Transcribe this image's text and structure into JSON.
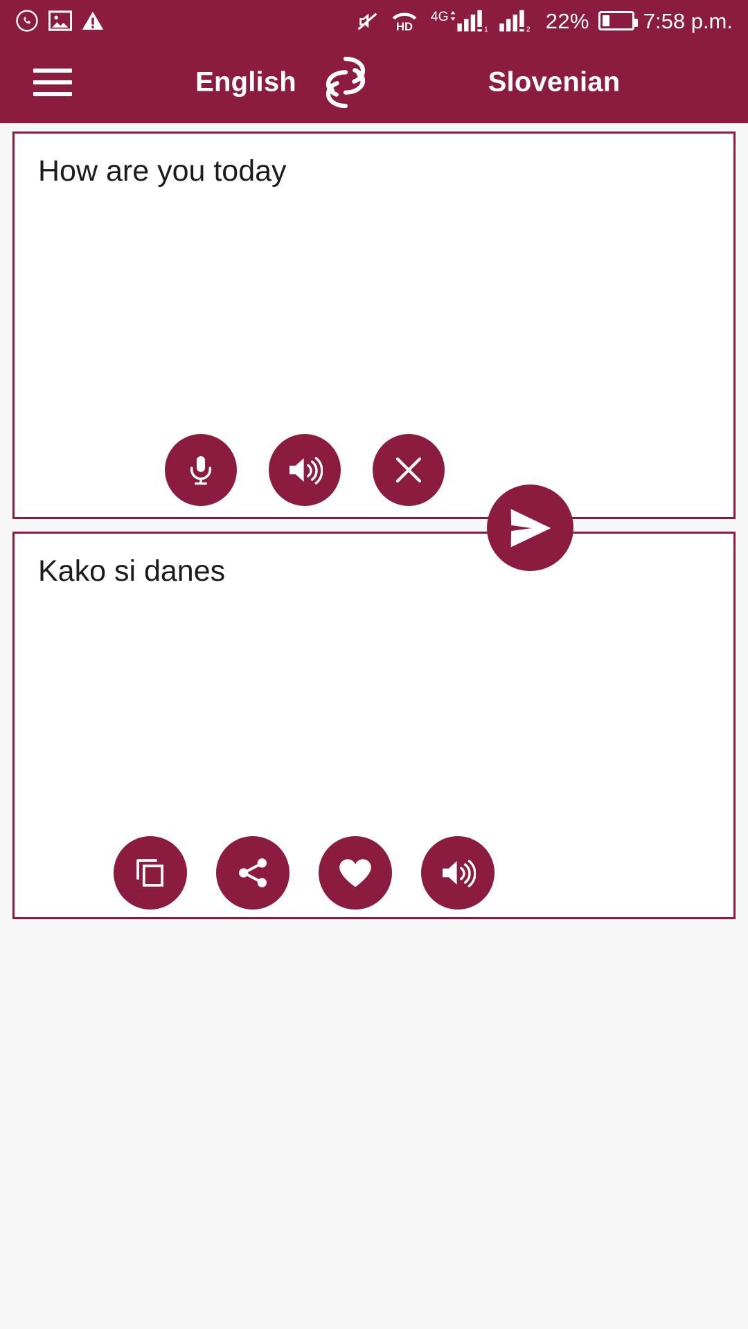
{
  "status_bar": {
    "left_icons": [
      "whatsapp-icon",
      "screenshot-image-icon",
      "warning-triangle-icon"
    ],
    "right_icons": [
      "silent-mode-icon",
      "volte-hd-icon",
      "signal-4g-icon",
      "signal-bars-icon"
    ],
    "network_label": "4G",
    "hd_label": "HD",
    "battery_percent": "22%",
    "battery_level": 22,
    "time": "7:58 p.m."
  },
  "app_bar": {
    "menu_icon": "hamburger-menu-icon",
    "source_language": "English",
    "target_language": "Slovenian",
    "swap_icon": "swap-languages-icon"
  },
  "source_card": {
    "text": "How are you today",
    "actions": [
      {
        "name": "microphone-button",
        "icon": "microphone-icon"
      },
      {
        "name": "speak-source-button",
        "icon": "volume-speaker-icon"
      },
      {
        "name": "clear-text-button",
        "icon": "close-x-icon"
      }
    ]
  },
  "send_button": {
    "name": "translate-send-button",
    "icon": "send-paper-plane-icon"
  },
  "target_card": {
    "text": "Kako si danes",
    "actions": [
      {
        "name": "copy-button",
        "icon": "copy-icon"
      },
      {
        "name": "share-button",
        "icon": "share-icon"
      },
      {
        "name": "favorite-button",
        "icon": "heart-icon"
      },
      {
        "name": "speak-target-button",
        "icon": "volume-speaker-icon"
      }
    ]
  },
  "colors": {
    "primary": "#8c1c3f",
    "on_primary": "#ffffff",
    "page_background": "#f7f7f7",
    "card_background": "#ffffff",
    "text": "#1c1c1c"
  }
}
